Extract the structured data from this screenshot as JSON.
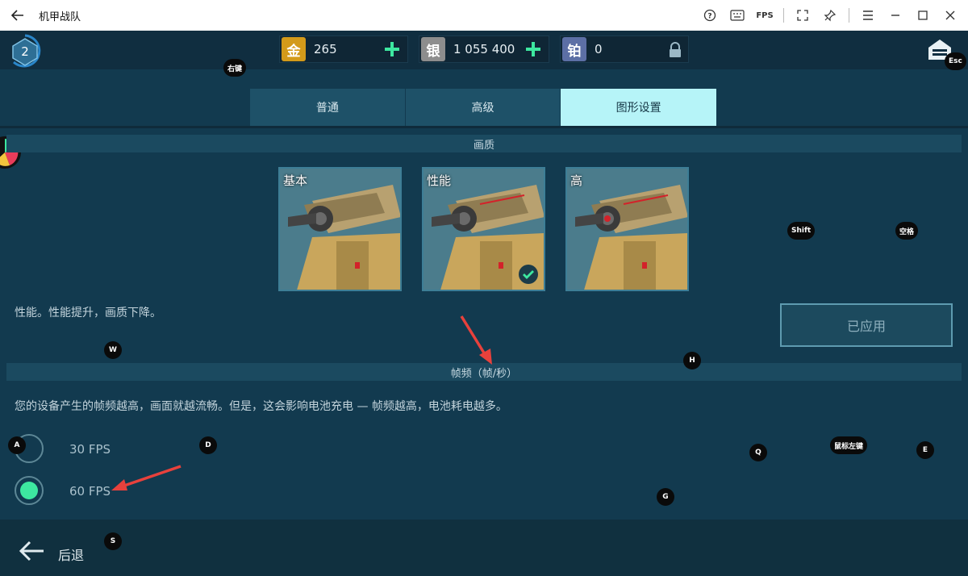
{
  "window": {
    "title": "机甲战队",
    "fps_label": "FPS"
  },
  "player": {
    "level": "2"
  },
  "resources": {
    "gold": {
      "icon_char": "金",
      "value": "265"
    },
    "silver": {
      "icon_char": "银",
      "value": "1 055 400"
    },
    "platinum": {
      "icon_char": "铂",
      "value": "0"
    }
  },
  "tabs": [
    {
      "label": "普通",
      "active": false
    },
    {
      "label": "高级",
      "active": false
    },
    {
      "label": "图形设置",
      "active": true
    }
  ],
  "quality": {
    "section_title": "画质",
    "options": [
      {
        "label": "基本",
        "selected": false
      },
      {
        "label": "性能",
        "selected": true
      },
      {
        "label": "高",
        "selected": false
      }
    ],
    "description": "性能。性能提升，画质下降。",
    "apply_label": "已应用"
  },
  "framerate": {
    "section_title": "帧频（帧/秒）",
    "description": "您的设备产生的帧频越高，画面就越流畅。但是，这会影响电池充电 — 帧频越高，电池耗电越多。",
    "options": [
      {
        "label": "30 FPS",
        "selected": false
      },
      {
        "label": "60 FPS",
        "selected": true
      }
    ]
  },
  "footer": {
    "back_label": "后退"
  },
  "key_hints": {
    "right_click": "右键",
    "esc": "Esc",
    "shift": "Shift",
    "space": "空格",
    "w": "W",
    "h": "H",
    "a": "A",
    "d": "D",
    "q": "Q",
    "left_click": "鼠标左键",
    "e": "E",
    "g": "G",
    "s": "S"
  },
  "colors": {
    "accent_green": "#3de8a0",
    "active_tab": "#b6f4f8",
    "annotation_red": "#e8413c"
  }
}
